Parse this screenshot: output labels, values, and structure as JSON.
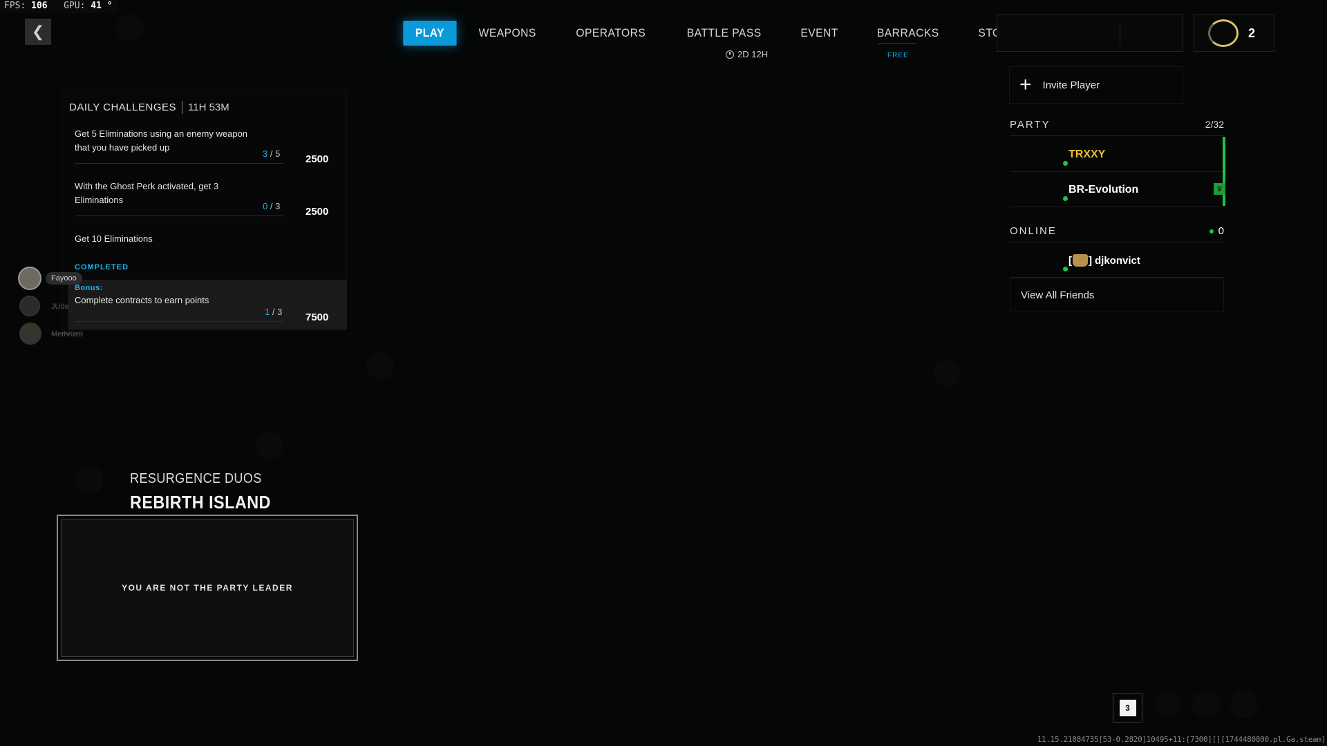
{
  "perf": {
    "fps_label": "FPS:",
    "fps_value": "106",
    "gpu_label": "GPU:",
    "gpu_value": "41 °"
  },
  "nav": {
    "back": "❮",
    "items": [
      "PLAY",
      "WEAPONS",
      "OPERATORS",
      "BATTLE PASS",
      "EVENT",
      "BARRACKS",
      "STORE"
    ],
    "event_timer": "2D 12H",
    "store_badge": "FREE",
    "accent": "#0a9ad9"
  },
  "top_right": {
    "count": "2"
  },
  "party": {
    "invite_label": "Invite Player",
    "title": "PARTY",
    "count": "2/32",
    "members": [
      {
        "name": "TRXXY",
        "color": "#f0c020"
      },
      {
        "name": "BR-Evolution",
        "color": "#ffffff"
      }
    ],
    "online_title": "ONLINE",
    "online_count": "0",
    "friends": [
      {
        "tag_open": "[",
        "tag_close": "]",
        "name": "djkonvict"
      }
    ],
    "view_all": "View All Friends",
    "status_color": "#1ec445"
  },
  "challenges": {
    "title": "DAILY CHALLENGES",
    "timer": "11H 53M",
    "items": [
      {
        "text": "Get 5 Eliminations using an enemy weapon that you have picked up",
        "progress_current": "3",
        "progress_total": "/ 5",
        "points": "2500"
      },
      {
        "text": "With the Ghost Perk activated, get 3 Eliminations",
        "progress_current": "0",
        "progress_total": "/ 3",
        "points": "2500"
      },
      {
        "text": "Get 10 Eliminations"
      }
    ],
    "completed_label": "COMPLETED",
    "bonus": {
      "label": "Bonus:",
      "text": "Complete contracts to earn points",
      "progress_current": "1",
      "progress_total": "/ 3",
      "points": "7500"
    }
  },
  "squad_avatars": [
    {
      "name": "Fayooo"
    },
    {
      "name": "JUde"
    },
    {
      "name": "MethKiz0"
    }
  ],
  "mode": {
    "subtitle": "RESURGENCE DUOS",
    "title": "REBIRTH ISLAND",
    "message": "YOU ARE NOT THE PARTY LEADER"
  },
  "bottom": {
    "squad_count": "3",
    "version": "11.15.21884735[53-0.2820]10495+11:[7300][][1744480800.pl.Ga.steam]"
  }
}
